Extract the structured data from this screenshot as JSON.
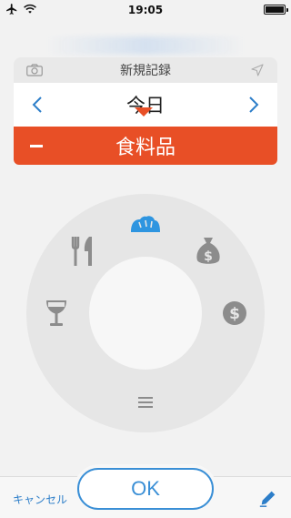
{
  "status_bar": {
    "time": "19:05",
    "icons": [
      "airplane-icon",
      "wifi-icon",
      "battery-icon"
    ]
  },
  "record_card": {
    "title": "新規記録",
    "camera_icon": "camera-icon",
    "location_icon": "location-arrow-icon",
    "date_label": "今日",
    "prev_icon": "chevron-left-icon",
    "next_icon": "chevron-right-icon",
    "category_label": "食料品",
    "toggle_icon": "minus-icon",
    "accent_color": "#e84f26"
  },
  "category_wheel": {
    "items": [
      {
        "name": "groceries",
        "icon": "bread-icon",
        "selected": true,
        "color": "#2e95e0"
      },
      {
        "name": "dining",
        "icon": "fork-knife-icon",
        "selected": false
      },
      {
        "name": "savings",
        "icon": "money-bag-icon",
        "selected": false
      },
      {
        "name": "drinks",
        "icon": "wine-glass-icon",
        "selected": false
      },
      {
        "name": "income",
        "icon": "dollar-coin-icon",
        "selected": false
      },
      {
        "name": "more",
        "icon": "menu-lines-icon",
        "selected": false
      }
    ]
  },
  "bottom_bar": {
    "cancel_label": "キャンセル",
    "ok_label": "OK",
    "edit_icon": "pencil-icon",
    "accent_color": "#3a8fd6"
  }
}
